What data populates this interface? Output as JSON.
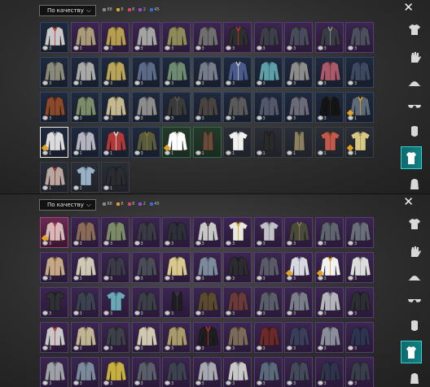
{
  "panels": [
    {
      "sort_label": "По качеству",
      "counts": [
        {
          "text": "88",
          "color": "#8a8a8a"
        },
        {
          "text": "8",
          "color": "#e0a526"
        },
        {
          "text": "8",
          "color": "#d9436c"
        },
        {
          "text": "2",
          "color": "#9a4cd9"
        },
        {
          "text": "45",
          "color": "#3c68d8"
        }
      ],
      "tiles": [
        {
          "color": "#c8c8c8",
          "acc": "#b43838",
          "tier": "blue",
          "qty": "3"
        },
        {
          "color": "#a89a7a",
          "acc": "#6a5a44",
          "tier": "purple",
          "qty": "3"
        },
        {
          "color": "#b59d52",
          "acc": "#7b6630",
          "tier": "purple",
          "qty": "3"
        },
        {
          "color": "#a4a4a4",
          "acc": "#666666",
          "tier": "purple",
          "qty": "3"
        },
        {
          "color": "#8e8a5a",
          "acc": "#6e6a3e",
          "tier": "purple",
          "qty": "3"
        },
        {
          "color": "#6f6f6f",
          "acc": "#444444",
          "tier": "purple",
          "qty": "3"
        },
        {
          "color": "#2e2e2e",
          "acc": "#b33a2a",
          "tier": "purple",
          "qty": "3"
        },
        {
          "color": "#3d3f48",
          "acc": "#292a30",
          "tier": "purple",
          "qty": "3"
        },
        {
          "color": "#484c5a",
          "acc": "#2f323c",
          "tier": "purple",
          "qty": "3"
        },
        {
          "color": "#3a3c44",
          "acc": "#8f8f8f",
          "tier": "purple",
          "qty": "3"
        },
        {
          "color": "#4c4f5d",
          "acc": "#2d2f38",
          "tier": "purple",
          "qty": "3"
        },
        {
          "color": "#8a8a7a",
          "acc": "#505050",
          "tier": "blue",
          "qty": "3"
        },
        {
          "color": "#a9a9a9",
          "acc": "#6d6d6d",
          "tier": "blue",
          "qty": "3"
        },
        {
          "color": "#b8a45a",
          "acc": "#7a6a30",
          "tier": "blue",
          "qty": "3"
        },
        {
          "color": "#5c6a88",
          "acc": "#3a4560",
          "tier": "blue",
          "qty": "3"
        },
        {
          "color": "#6e8a72",
          "acc": "#4b6250",
          "tier": "blue",
          "qty": "3"
        },
        {
          "color": "#767c8a",
          "acc": "#4d5260",
          "tier": "blue",
          "qty": "3"
        },
        {
          "color": "#4a5a8a",
          "acc": "#c8c8c8",
          "tier": "blue",
          "qty": "3"
        },
        {
          "color": "#5fa0a8",
          "acc": "#3b7078",
          "tier": "blue",
          "qty": "3"
        },
        {
          "color": "#8c8c8c",
          "acc": "#5a5a5a",
          "tier": "blue",
          "qty": "3"
        },
        {
          "color": "#a85a6a",
          "acc": "#7a3c48",
          "tier": "blue",
          "qty": "3"
        },
        {
          "color": "#3e4860",
          "acc": "#283044",
          "tier": "blue",
          "qty": "3"
        },
        {
          "color": "#8a4a2a",
          "acc": "#4a2a1a",
          "tier": "blue",
          "qty": "3"
        },
        {
          "color": "#7c8c6a",
          "acc": "#4a5440",
          "tier": "blue",
          "qty": "3"
        },
        {
          "color": "#c4b890",
          "acc": "#8a7c5a",
          "tier": "blue",
          "qty": "3"
        },
        {
          "color": "#8c8c8c",
          "acc": "#5c5c5c",
          "tier": "blue",
          "qty": "3"
        },
        {
          "color": "#3a3a3a",
          "acc": "#5a5a5a",
          "tier": "blue",
          "qty": "3"
        },
        {
          "color": "#4a4440",
          "acc": "#2e2a28",
          "tier": "blue",
          "qty": "3"
        },
        {
          "color": "#5a5a5a",
          "acc": "#3c3c3c",
          "tier": "blue",
          "qty": "3"
        },
        {
          "color": "#52586a",
          "acc": "#363a48",
          "tier": "blue",
          "qty": "3"
        },
        {
          "color": "#6a6a78",
          "acc": "#474752",
          "tier": "blue",
          "qty": "3"
        },
        {
          "color": "#141414",
          "acc": "#2a2a2a",
          "tier": "blue",
          "qty": "3"
        },
        {
          "color": "#5e6a78",
          "acc": "#d4a020",
          "tier": "blue",
          "qty": "1",
          "star": true
        },
        {
          "color": "#dcdcdc",
          "acc": "#8a8aa0",
          "tier": "blue",
          "qty": "1",
          "star": true,
          "sel": true
        },
        {
          "color": "#b4b4c0",
          "acc": "#5a5a70",
          "tier": "blue",
          "qty": "1"
        },
        {
          "color": "#b03a3a",
          "acc": "#e0e0e0",
          "tier": "blue",
          "qty": "1"
        },
        {
          "color": "#5a5a3c",
          "acc": "#8a7a3c",
          "tier": "blue",
          "qty": "3"
        },
        {
          "color": "#ffffff",
          "acc": "#cfcfcf",
          "tier": "green",
          "qty": "1",
          "star": true
        },
        {
          "color": "#6a4a3a",
          "acc": "#4a3226",
          "tier": "green",
          "qty": "1",
          "shape": "vest"
        },
        {
          "color": "#f0f0f0",
          "acc": "#c8c8c8",
          "tier": "",
          "qty": "1",
          "shape": "tee"
        },
        {
          "color": "#2a2a2a",
          "acc": "#1a1a1a",
          "tier": "",
          "qty": "1",
          "shape": "vest"
        },
        {
          "color": "#8a8060",
          "acc": "#5a5440",
          "tier": "",
          "qty": "1",
          "shape": "vest"
        },
        {
          "color": "#c05a4a",
          "acc": "#8a3a30",
          "tier": "",
          "qty": "1",
          "shape": "tee"
        },
        {
          "color": "#d8c888",
          "acc": "#a8985a",
          "tier": "",
          "qty": "1",
          "star": true,
          "shape": "tee"
        },
        {
          "color": "#b8a8a0",
          "acc": "#8a2a2a",
          "tier": "",
          "qty": "1"
        },
        {
          "color": "#9ab0c4",
          "acc": "#6a8094",
          "tier": "",
          "qty": "1",
          "shape": "tee"
        },
        {
          "color": "#2a2c30",
          "acc": "#1a1c20",
          "tier": "",
          "qty": "1"
        }
      ],
      "side_icons": [
        "shirt-icon",
        "glove-icon",
        "hat-icon",
        "glasses-icon",
        "mask-icon",
        "outfit-icon",
        "backpack-icon"
      ],
      "active_side": 5
    },
    {
      "sort_label": "По качеству",
      "counts": [
        {
          "text": "88",
          "color": "#8a8a8a"
        },
        {
          "text": "8",
          "color": "#e0a526"
        },
        {
          "text": "8",
          "color": "#d9436c"
        },
        {
          "text": "2",
          "color": "#9a4cd9"
        },
        {
          "text": "45",
          "color": "#3c68d8"
        }
      ],
      "tiles": [
        {
          "color": "#d8b8b8",
          "acc": "#a03a4a",
          "tier": "pink",
          "qty": "3",
          "star": true
        },
        {
          "color": "#8a6a5a",
          "acc": "#5a4036",
          "tier": "purple",
          "qty": "3"
        },
        {
          "color": "#7c8a6a",
          "acc": "#4e5842",
          "tier": "purple",
          "qty": "3"
        },
        {
          "color": "#3a3a44",
          "acc": "#22222a",
          "tier": "purple",
          "qty": "3"
        },
        {
          "color": "#2e3038",
          "acc": "#1c1e24",
          "tier": "purple",
          "qty": "3"
        },
        {
          "color": "#c8c8c8",
          "acc": "#2a2a2a",
          "tier": "purple",
          "qty": "3"
        },
        {
          "color": "#e8e8e0",
          "acc": "#d4a020",
          "tier": "purple",
          "qty": "3",
          "shape": "tee"
        },
        {
          "color": "#c0c0c8",
          "acc": "#8a8a94",
          "tier": "purple",
          "qty": "3",
          "shape": "tee"
        },
        {
          "color": "#4a4a3a",
          "acc": "#8a8050",
          "tier": "purple",
          "qty": "3"
        },
        {
          "color": "#60646e",
          "acc": "#3c3e46",
          "tier": "purple",
          "qty": "3"
        },
        {
          "color": "#6a6e7a",
          "acc": "#424652",
          "tier": "purple",
          "qty": "3"
        },
        {
          "color": "#c4a888",
          "acc": "#8a6a4a",
          "tier": "purple",
          "qty": "3"
        },
        {
          "color": "#cfc8b4",
          "acc": "#9a9480",
          "tier": "purple",
          "qty": "3"
        },
        {
          "color": "#3a3a48",
          "acc": "#242430",
          "tier": "purple",
          "qty": "3"
        },
        {
          "color": "#4a4c58",
          "acc": "#2e3038",
          "tier": "purple",
          "qty": "3"
        },
        {
          "color": "#d8c890",
          "acc": "#a8985a",
          "tier": "purple",
          "qty": "3"
        },
        {
          "color": "#7c8a9c",
          "acc": "#52606e",
          "tier": "purple",
          "qty": "3"
        },
        {
          "color": "#2c2c30",
          "acc": "#1a1a1e",
          "tier": "purple",
          "qty": "3"
        },
        {
          "color": "#5a5a68",
          "acc": "#383844",
          "tier": "purple",
          "qty": "3"
        },
        {
          "color": "#d8d8e0",
          "acc": "#a0a0b0",
          "tier": "purple",
          "qty": "3",
          "star": true
        },
        {
          "color": "#f2f2f2",
          "acc": "#d4a020",
          "tier": "purple",
          "qty": "3",
          "star": true
        },
        {
          "color": "#dcdcdc",
          "acc": "#a8a8a8",
          "tier": "purple",
          "qty": "3"
        },
        {
          "color": "#2e3034",
          "acc": "#1c1e22",
          "tier": "purple",
          "qty": "3",
          "shape": "tee"
        },
        {
          "color": "#3c4250",
          "acc": "#262a34",
          "tier": "purple",
          "qty": "3"
        },
        {
          "color": "#6aa8b8",
          "acc": "#3e7684",
          "tier": "purple",
          "qty": "3",
          "shape": "tee"
        },
        {
          "color": "#3c3e48",
          "acc": "#26282e",
          "tier": "purple",
          "qty": "3"
        },
        {
          "color": "#1e1e22",
          "acc": "#3a3a40",
          "tier": "purple",
          "qty": "3",
          "shape": "vest"
        },
        {
          "color": "#5a4a30",
          "acc": "#3a3020",
          "tier": "purple",
          "qty": "3"
        },
        {
          "color": "#6a3a3a",
          "acc": "#3a2424",
          "tier": "purple",
          "qty": "3"
        },
        {
          "color": "#5a5e6a",
          "acc": "#3a3c44",
          "tier": "purple",
          "qty": "3"
        },
        {
          "color": "#7a7e8a",
          "acc": "#50525a",
          "tier": "purple",
          "qty": "3"
        },
        {
          "color": "#b4b4bc",
          "acc": "#7a7a84",
          "tier": "purple",
          "qty": "3"
        },
        {
          "color": "#2c2e34",
          "acc": "#1a1c20",
          "tier": "purple",
          "qty": "3"
        },
        {
          "color": "#c8c8c8",
          "acc": "#b03a3a",
          "tier": "purple",
          "qty": "3"
        },
        {
          "color": "#c0b494",
          "acc": "#8a7e60",
          "tier": "purple",
          "qty": "3"
        },
        {
          "color": "#3c4048",
          "acc": "#262830",
          "tier": "purple",
          "qty": "3"
        },
        {
          "color": "#d0c8b0",
          "acc": "#9a9480",
          "tier": "purple",
          "qty": "3"
        },
        {
          "color": "#a89a6a",
          "acc": "#6e6440",
          "tier": "purple",
          "qty": "3"
        },
        {
          "color": "#1e1e1e",
          "acc": "#c03030",
          "tier": "purple",
          "qty": "3"
        },
        {
          "color": "#7a6a5a",
          "acc": "#4e4238",
          "tier": "purple",
          "qty": "3"
        },
        {
          "color": "#6a2a2a",
          "acc": "#3c1a1a",
          "tier": "purple",
          "qty": "3"
        },
        {
          "color": "#3a3e58",
          "acc": "#242838",
          "tier": "purple",
          "qty": "3"
        },
        {
          "color": "#8a8e9a",
          "acc": "#5c606a",
          "tier": "purple",
          "qty": "3"
        },
        {
          "color": "#2e3450",
          "acc": "#1c2032",
          "tier": "purple",
          "qty": "3"
        },
        {
          "color": "#a0a0a8",
          "acc": "#66666e",
          "tier": "purple",
          "qty": "3"
        },
        {
          "color": "#7a8a9a",
          "acc": "#4e5a66",
          "tier": "purple",
          "qty": "3"
        },
        {
          "color": "#c8b040",
          "acc": "#8a7a28",
          "tier": "purple",
          "qty": "3"
        },
        {
          "color": "#5a5e6a",
          "acc": "#3a3c44",
          "tier": "purple",
          "qty": "3"
        },
        {
          "color": "#3e4250",
          "acc": "#282a34",
          "tier": "purple",
          "qty": "3"
        },
        {
          "color": "#a8a8b0",
          "acc": "#70707a",
          "tier": "purple",
          "qty": "3"
        },
        {
          "color": "#c8c8c8",
          "acc": "#8a8a8a",
          "tier": "purple",
          "qty": "3"
        },
        {
          "color": "#5a6a7a",
          "acc": "#3a4652",
          "tier": "purple",
          "qty": "3"
        },
        {
          "color": "#444a5a",
          "acc": "#2a2e3a",
          "tier": "purple",
          "qty": "3"
        },
        {
          "color": "#30344a",
          "acc": "#1e2030",
          "tier": "purple",
          "qty": "3"
        },
        {
          "color": "#3a3e4a",
          "acc": "#242630",
          "tier": "purple",
          "qty": "3"
        }
      ],
      "side_icons": [
        "shirt-icon",
        "glove-icon",
        "hat-icon",
        "glasses-icon",
        "mask-icon",
        "outfit-icon",
        "backpack-icon"
      ],
      "active_side": 5
    }
  ]
}
